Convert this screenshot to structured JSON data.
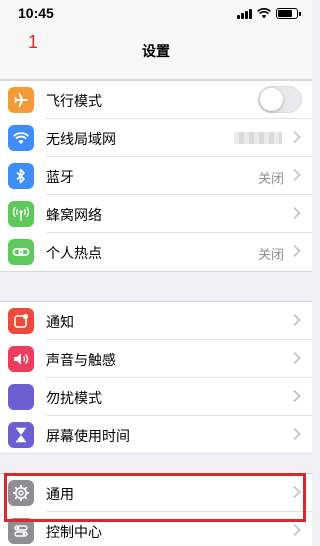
{
  "status": {
    "time": "10:45",
    "battery_level": 0.9
  },
  "annotation": {
    "step_number": "1"
  },
  "nav": {
    "title": "设置"
  },
  "colors": {
    "airplane": "#f29b38",
    "wifi": "#3f8ef7",
    "bluetooth": "#3f8ef7",
    "cellular": "#5cc95a",
    "hotspot": "#5cc95a",
    "notifications": "#ec4b3b",
    "sounds": "#ec3d5c",
    "dnd": "#6c5fd2",
    "screen_time": "#6c5fd2",
    "general": "#8e8e93",
    "control_center": "#8e8e93",
    "highlight": "#d62b2b"
  },
  "group1": [
    {
      "id": "airplane",
      "label": "飞行模式",
      "icon": "airplane-icon",
      "control": "toggle",
      "on": false
    },
    {
      "id": "wifi",
      "label": "无线局域网",
      "icon": "wifi-icon",
      "value": ""
    },
    {
      "id": "bluetooth",
      "label": "蓝牙",
      "icon": "bluetooth-icon",
      "value": "关闭"
    },
    {
      "id": "cellular",
      "label": "蜂窝网络",
      "icon": "cellular-antenna-icon",
      "value": ""
    },
    {
      "id": "hotspot",
      "label": "个人热点",
      "icon": "hotspot-link-icon",
      "value": "关闭"
    }
  ],
  "group2": [
    {
      "id": "notifications",
      "label": "通知",
      "icon": "notifications-icon"
    },
    {
      "id": "sounds",
      "label": "声音与触感",
      "icon": "speaker-icon"
    },
    {
      "id": "dnd",
      "label": "勿扰模式",
      "icon": "moon-icon"
    },
    {
      "id": "screen_time",
      "label": "屏幕使用时间",
      "icon": "hourglass-icon"
    },
    {
      "id": "general",
      "label": "通用",
      "icon": "gear-icon"
    },
    {
      "id": "control_center",
      "label": "控制中心",
      "icon": "switches-icon"
    }
  ]
}
